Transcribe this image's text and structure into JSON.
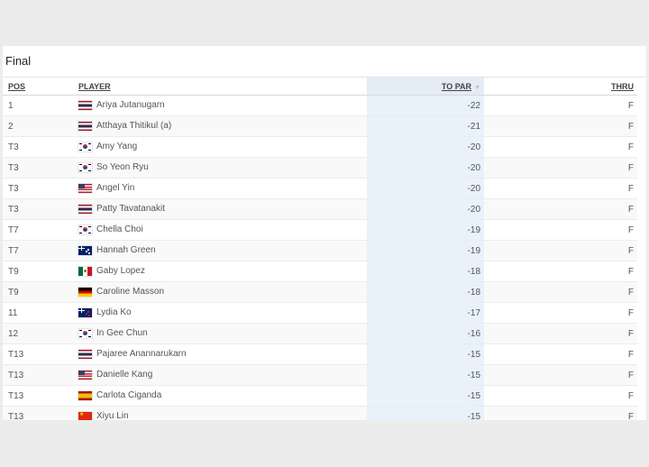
{
  "title": "Final",
  "headers": {
    "pos": "POS",
    "player": "PLAYER",
    "topar": "TO PAR",
    "thru": "THRU"
  },
  "rows": [
    {
      "pos": "1",
      "flag": "th",
      "player": "Ariya Jutanugarn",
      "topar": "-22",
      "thru": "F"
    },
    {
      "pos": "2",
      "flag": "th",
      "player": "Atthaya Thitikul (a)",
      "topar": "-21",
      "thru": "F"
    },
    {
      "pos": "T3",
      "flag": "kr",
      "player": "Amy Yang",
      "topar": "-20",
      "thru": "F"
    },
    {
      "pos": "T3",
      "flag": "kr",
      "player": "So Yeon Ryu",
      "topar": "-20",
      "thru": "F"
    },
    {
      "pos": "T3",
      "flag": "us",
      "player": "Angel Yin",
      "topar": "-20",
      "thru": "F"
    },
    {
      "pos": "T3",
      "flag": "th",
      "player": "Patty Tavatanakit",
      "topar": "-20",
      "thru": "F"
    },
    {
      "pos": "T7",
      "flag": "kr",
      "player": "Chella Choi",
      "topar": "-19",
      "thru": "F"
    },
    {
      "pos": "T7",
      "flag": "au",
      "player": "Hannah Green",
      "topar": "-19",
      "thru": "F"
    },
    {
      "pos": "T9",
      "flag": "mx",
      "player": "Gaby Lopez",
      "topar": "-18",
      "thru": "F"
    },
    {
      "pos": "T9",
      "flag": "de",
      "player": "Caroline Masson",
      "topar": "-18",
      "thru": "F"
    },
    {
      "pos": "11",
      "flag": "nz",
      "player": "Lydia Ko",
      "topar": "-17",
      "thru": "F"
    },
    {
      "pos": "12",
      "flag": "kr",
      "player": "In Gee Chun",
      "topar": "-16",
      "thru": "F"
    },
    {
      "pos": "T13",
      "flag": "th",
      "player": "Pajaree Anannarukarn",
      "topar": "-15",
      "thru": "F"
    },
    {
      "pos": "T13",
      "flag": "us",
      "player": "Danielle Kang",
      "topar": "-15",
      "thru": "F"
    },
    {
      "pos": "T13",
      "flag": "es",
      "player": "Carlota Ciganda",
      "topar": "-15",
      "thru": "F"
    },
    {
      "pos": "T13",
      "flag": "cn",
      "player": "Xiyu Lin",
      "topar": "-15",
      "thru": "F"
    }
  ]
}
